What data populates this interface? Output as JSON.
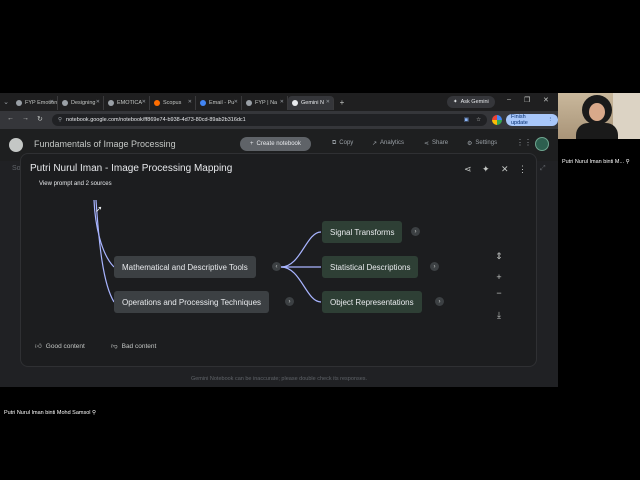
{
  "browser": {
    "tabs": [
      {
        "label": "FYP Emotion",
        "active": false
      },
      {
        "label": "Designing",
        "active": false
      },
      {
        "label": "EMOTICA",
        "active": false
      },
      {
        "label": "Scopus",
        "active": false
      },
      {
        "label": "Email - Pu",
        "active": false
      },
      {
        "label": "FYP | Na",
        "active": false
      },
      {
        "label": "Gemini N",
        "active": true
      }
    ],
    "ask_gemini": "Ask Gemini",
    "url": "notebook.google.com/notebook/ff869e74-b938-4d73-80cd-89ab2b316dc1",
    "finish_update": "Finish update"
  },
  "notebook": {
    "title": "Fundamentals of Image Processing",
    "create_button": "Create notebook",
    "actions": {
      "copy": "Copy",
      "analytics": "Analytics",
      "share": "Share",
      "settings": "Settings"
    },
    "footer_note": "Gemini Notebook can be inaccurate; please double check its responses.",
    "bg_peek": "So"
  },
  "mindmap": {
    "title": "Putri Nurul Iman - Image Processing Mapping",
    "subtitle": "View prompt and 2 sources",
    "nodes": {
      "math": "Mathematical and Descriptive Tools",
      "ops": "Operations and Processing Techniques",
      "signal": "Signal Transforms",
      "stat": "Statistical Descriptions",
      "obj": "Object Representations"
    },
    "feedback": {
      "good": "Good content",
      "bad": "Bad content"
    }
  },
  "participants": {
    "right_name": "Putri Nurul Iman binti M...",
    "left_name": "Putri Nurul Iman binti Mohd Samsol"
  },
  "colors": {
    "accent": "#a8c7fa",
    "node": "#3c4043",
    "leaf_node": "#2e3f35",
    "connector": "#a8b4ff"
  }
}
